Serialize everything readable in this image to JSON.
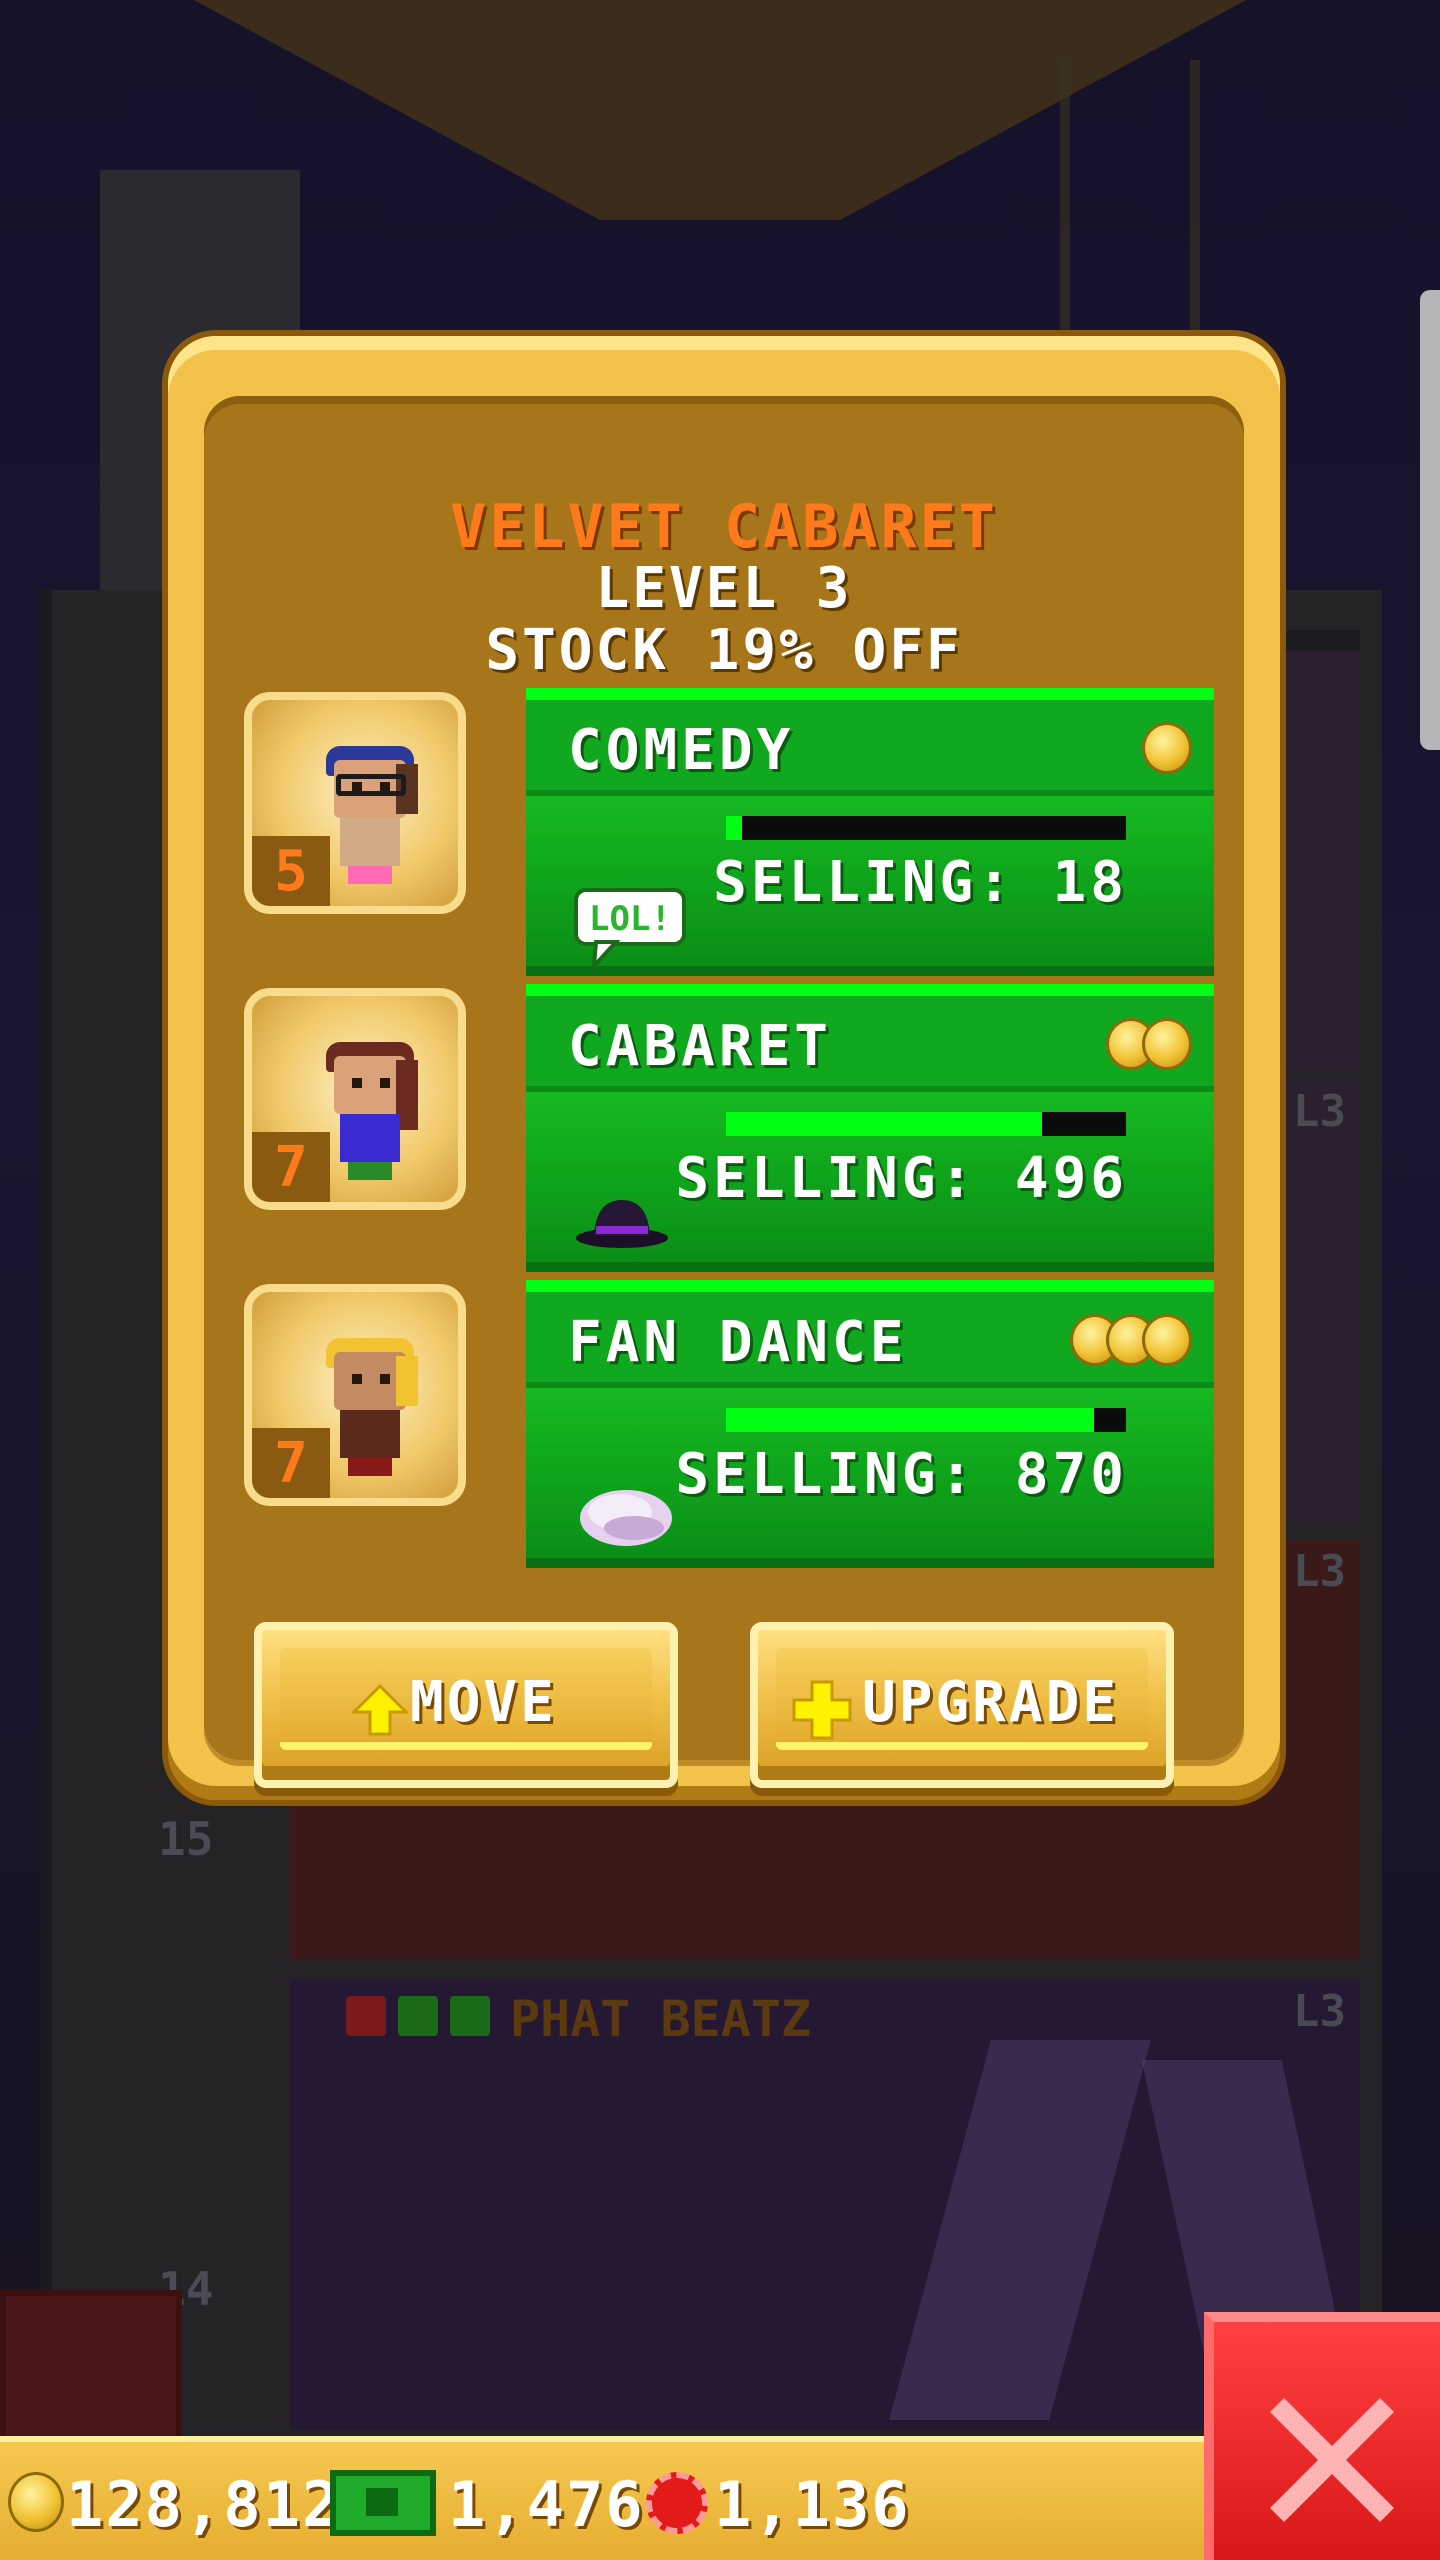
{
  "business": {
    "name": "VELVET CABARET",
    "level": "LEVEL 3",
    "discount": "STOCK 19% OFF"
  },
  "products": [
    {
      "name": "COMEDY",
      "selling": "SELLING: 18",
      "stock_fraction": 0.04,
      "tier_coins": 1,
      "product_icon": "lol-speech-bubble-icon",
      "staff_dream_level": "5",
      "icon_text": "LOL!"
    },
    {
      "name": "CABARET",
      "selling": "SELLING: 496",
      "stock_fraction": 0.79,
      "tier_coins": 2,
      "product_icon": "bowler-hat-icon",
      "staff_dream_level": "7"
    },
    {
      "name": "FAN DANCE",
      "selling": "SELLING: 870",
      "stock_fraction": 0.92,
      "tier_coins": 3,
      "product_icon": "feather-fan-icon",
      "staff_dream_level": "7"
    }
  ],
  "buttons": {
    "move": "MOVE",
    "upgrade": "UPGRADE"
  },
  "background": {
    "floor_numbers": [
      "15",
      "14"
    ],
    "floor_tags": [
      "L3",
      "L3",
      "L3"
    ],
    "lower_floor_name": "PHAT BEATZ"
  },
  "currency": {
    "coins": "128,812",
    "bux": "1,476",
    "chips": "1,136"
  },
  "colors": {
    "title_orange": "#ff7a1a",
    "card_green": "#10a81c",
    "bar_fill": "#00ff12",
    "panel_gold": "#f3c24a",
    "close_red": "#e21a1a"
  }
}
